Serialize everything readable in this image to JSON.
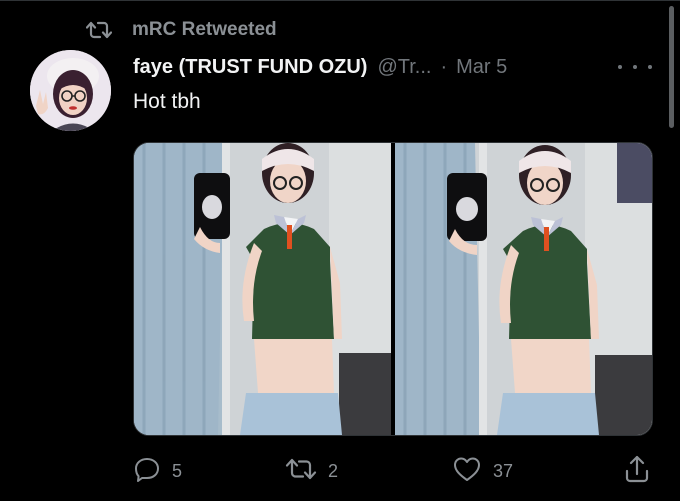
{
  "retweet": {
    "label": "mRC Retweeted"
  },
  "tweet": {
    "display_name": "faye (TRUST FUND OZU)",
    "handle": "@Tr...",
    "separator": "·",
    "date": "Mar 5",
    "text": "Hot tbh",
    "media_count": 2
  },
  "actions": {
    "reply_count": "5",
    "retweet_count": "2",
    "like_count": "37"
  },
  "colors": {
    "background": "#000000",
    "text_primary": "#e7e9ea",
    "text_secondary": "#71767b"
  },
  "icons": [
    "retweet-icon",
    "more-icon",
    "reply-icon",
    "like-icon",
    "share-icon"
  ]
}
